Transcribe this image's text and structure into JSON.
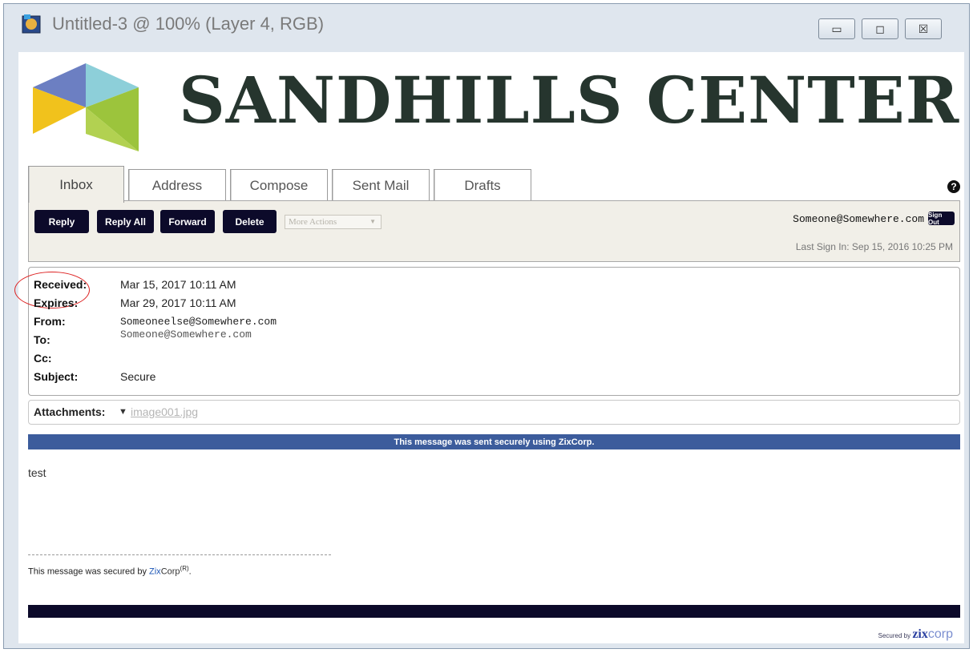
{
  "window": {
    "title": "Untitled-3 @ 100% (Layer 4, RGB)",
    "buttons": {
      "minimize": "▭",
      "maximize": "◻",
      "close": "☒"
    }
  },
  "banner": {
    "title": "SANDHILLS CENTER"
  },
  "tabs": [
    {
      "label": "Inbox",
      "active": true
    },
    {
      "label": "Address",
      "active": false
    },
    {
      "label": "Compose",
      "active": false
    },
    {
      "label": "Sent Mail",
      "active": false
    },
    {
      "label": "Drafts",
      "active": false
    }
  ],
  "toolbar": {
    "reply": "Reply",
    "reply_all": "Reply All",
    "forward": "Forward",
    "delete": "Delete",
    "more_actions": "More Actions"
  },
  "user": {
    "email": "Someone@Somewhere.com",
    "sign_out": "Sign Out",
    "last_sign_in": "Last Sign In: Sep 15, 2016 10:25 PM"
  },
  "message": {
    "received_label": "Received:",
    "received": "Mar 15, 2017 10:11 AM",
    "expires_label": "Expires:",
    "expires": "Mar 29, 2017 10:11 AM",
    "from_label": "From:",
    "from": "Someoneelse@Somewhere.com",
    "to_label": "To:",
    "to": "Someone@Somewhere.com",
    "cc_label": "Cc:",
    "cc": "",
    "subject_label": "Subject:",
    "subject": "Secure"
  },
  "attachments": {
    "label": "Attachments:",
    "files": [
      "image001.jpg"
    ]
  },
  "secure_notice": "This message was sent securely using ZixCorp.",
  "body": "test",
  "signature": {
    "prefix": "This message was secured by ",
    "brand": "Zix",
    "corp": "Corp",
    "mark": "(R)",
    "suffix": "."
  },
  "footer": {
    "secured_by": "Secured by",
    "brand": "zix",
    "corp": "corp"
  },
  "colors": {
    "navy": "#0c0a2a",
    "banner": "#3c5c9c",
    "title_text": "#26352e"
  }
}
